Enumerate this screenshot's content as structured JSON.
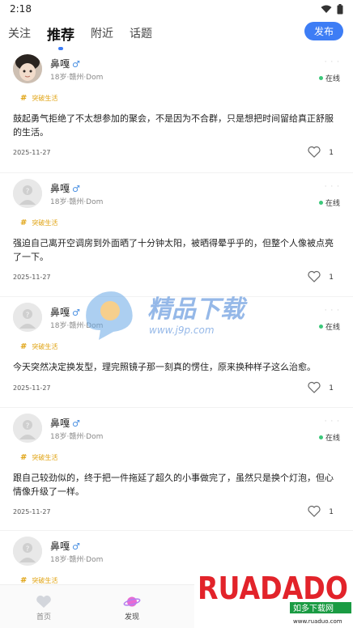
{
  "status_bar": {
    "time": "2:18"
  },
  "top_nav": {
    "tabs": [
      {
        "label": "关注"
      },
      {
        "label": "推荐"
      },
      {
        "label": "附近"
      },
      {
        "label": "话题"
      }
    ],
    "active_tab": "推荐",
    "publish_label": "发布"
  },
  "posts": [
    {
      "name": "鼻嘎",
      "gender": "♂",
      "meta": "18岁·赣州·Dom",
      "status": "在线",
      "topic": "突破生活",
      "content": "鼓起勇气拒绝了不太想参加的聚会，不是因为不合群，只是想把时间留给真正舒服的生活。",
      "date": "2025-11-27",
      "likes": "1"
    },
    {
      "name": "鼻嘎",
      "gender": "♂",
      "meta": "18岁·赣州·Dom",
      "status": "在线",
      "topic": "突破生活",
      "content": "强迫自己离开空调房到外面晒了十分钟太阳，被晒得晕乎乎的，但整个人像被点亮了一下。",
      "date": "2025-11-27",
      "likes": "1"
    },
    {
      "name": "鼻嘎",
      "gender": "♂",
      "meta": "18岁·赣州·Dom",
      "status": "在线",
      "topic": "突破生活",
      "content": "今天突然决定换发型，理完照镜子那一刻真的愣住，原来换种样子这么治愈。",
      "date": "2025-11-27",
      "likes": "1"
    },
    {
      "name": "鼻嘎",
      "gender": "♂",
      "meta": "18岁·赣州·Dom",
      "status": "在线",
      "topic": "突破生活",
      "content": "跟自己较劲似的，终于把一件拖延了超久的小事做完了，虽然只是换个灯泡，但心情像升级了一样。",
      "date": "2025-11-27",
      "likes": "1"
    },
    {
      "name": "鼻嘎",
      "gender": "♂",
      "meta": "18岁·赣州·Dom",
      "status": "在线",
      "topic": "突破生活",
      "content": "",
      "date": "",
      "likes": ""
    }
  ],
  "bottom_nav": {
    "items": [
      {
        "label": "首页",
        "icon": "heart-icon"
      },
      {
        "label": "发现",
        "icon": "planet-icon"
      }
    ],
    "active": "发现"
  },
  "watermark": {
    "title": "精品下载",
    "url": "www.j9p.com"
  },
  "ad": {
    "brand": "RUADADO",
    "subtitle": "如多下载网",
    "url": "www.ruaduo.com"
  },
  "colors": {
    "accent": "#3d7df5",
    "online": "#3cc87a",
    "topic": "#e0a312"
  }
}
